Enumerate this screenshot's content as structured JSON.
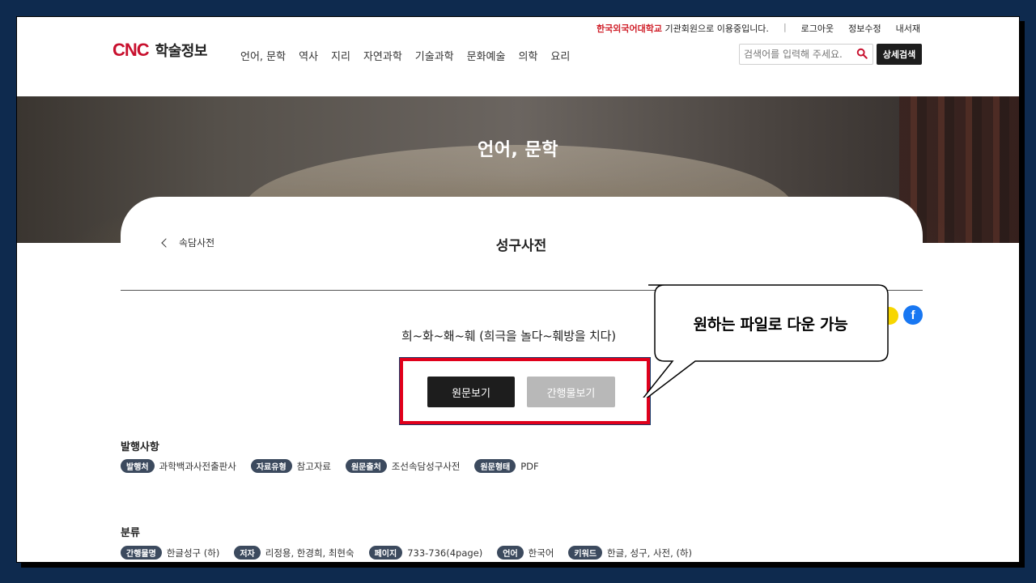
{
  "utility": {
    "institution": "한국외국어대학교",
    "institution_suffix": " 기관회원으로 이용중입니다.",
    "separator": "|",
    "logout": "로그아웃",
    "edit_profile": "정보수정",
    "my_library": "내서재"
  },
  "header": {
    "logo_mark": "CNC",
    "logo_name": "학술정보",
    "nav": [
      "언어, 문학",
      "역사",
      "지리",
      "자연과학",
      "기술과학",
      "문화예술",
      "의학",
      "요리"
    ],
    "search_placeholder": "검색어를 입력해 주세요.",
    "advanced_search": "상세검색"
  },
  "banner": {
    "title": "언어, 문학"
  },
  "detail": {
    "back_label": "속담사전",
    "page_title": "성구사전",
    "doc_title": "희~화~홰~훼 (희극을 놀다~훼방을 치다)",
    "view_original": "원문보기",
    "view_publication": "간행물보기",
    "facebook_glyph": "f"
  },
  "callout": {
    "text": "원하는 파일로 다운 가능"
  },
  "publication": {
    "heading": "발행사항",
    "items": [
      {
        "tag": "발행처",
        "value": "과학백과사전출판사"
      },
      {
        "tag": "자료유형",
        "value": "참고자료"
      },
      {
        "tag": "원문출처",
        "value": "조선속담성구사전"
      },
      {
        "tag": "원문형태",
        "value": "PDF"
      }
    ]
  },
  "classification": {
    "heading": "분류",
    "items": [
      {
        "tag": "간행물명",
        "value": "한글성구 (하)"
      },
      {
        "tag": "저자",
        "value": "리정용, 한경희, 최현숙"
      },
      {
        "tag": "페이지",
        "value": "733-736(4page)"
      },
      {
        "tag": "언어",
        "value": "한국어"
      },
      {
        "tag": "키워드",
        "value": "한글, 성구, 사전, (하)"
      }
    ]
  },
  "colors": {
    "brand_red": "#c8102e",
    "highlight_red": "#e0001b",
    "tag_bg": "#3c4a5e",
    "facebook": "#1877f2",
    "kakao": "#f7d600"
  }
}
